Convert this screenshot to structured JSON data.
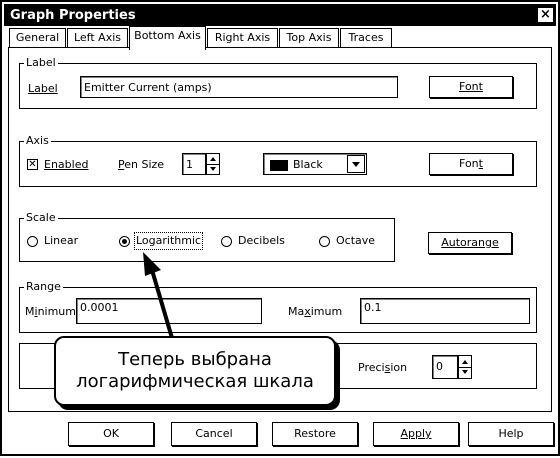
{
  "window": {
    "title": "Graph Properties",
    "close_glyph": "×"
  },
  "tabs": [
    "General",
    "Left Axis",
    "Bottom Axis",
    "Right Axis",
    "Top Axis",
    "Traces"
  ],
  "active_tab": "Bottom Axis",
  "label_group": {
    "title": "Label",
    "field_label": "Label",
    "value": "Emitter Current (amps)",
    "font_button": "Font"
  },
  "axis_group": {
    "title": "Axis",
    "enabled_label": "Enabled",
    "enabled_checked": true,
    "pen_size_label": "Pen Size",
    "pen_size_value": "1",
    "color_value": "Black",
    "color_swatch": "#000000",
    "font_button": "Font"
  },
  "scale_group": {
    "title": "Scale",
    "options": [
      "Linear",
      "Logarithmic",
      "Decibels",
      "Octave"
    ],
    "selected": "Logarithmic",
    "autorange_button": "Autorange"
  },
  "range_group": {
    "title": "Range",
    "minimum_label": "Minimum",
    "minimum_value": "0.0001",
    "maximum_label": "Maximum",
    "maximum_value": "0.1"
  },
  "precision_group": {
    "precision_label": "Precision",
    "precision_value": "0"
  },
  "buttons": {
    "ok": "OK",
    "cancel": "Cancel",
    "restore": "Restore",
    "apply": "Apply",
    "help": "Help"
  },
  "callout": {
    "line1": "Теперь выбрана",
    "line2": "логарифмическая шкала"
  }
}
